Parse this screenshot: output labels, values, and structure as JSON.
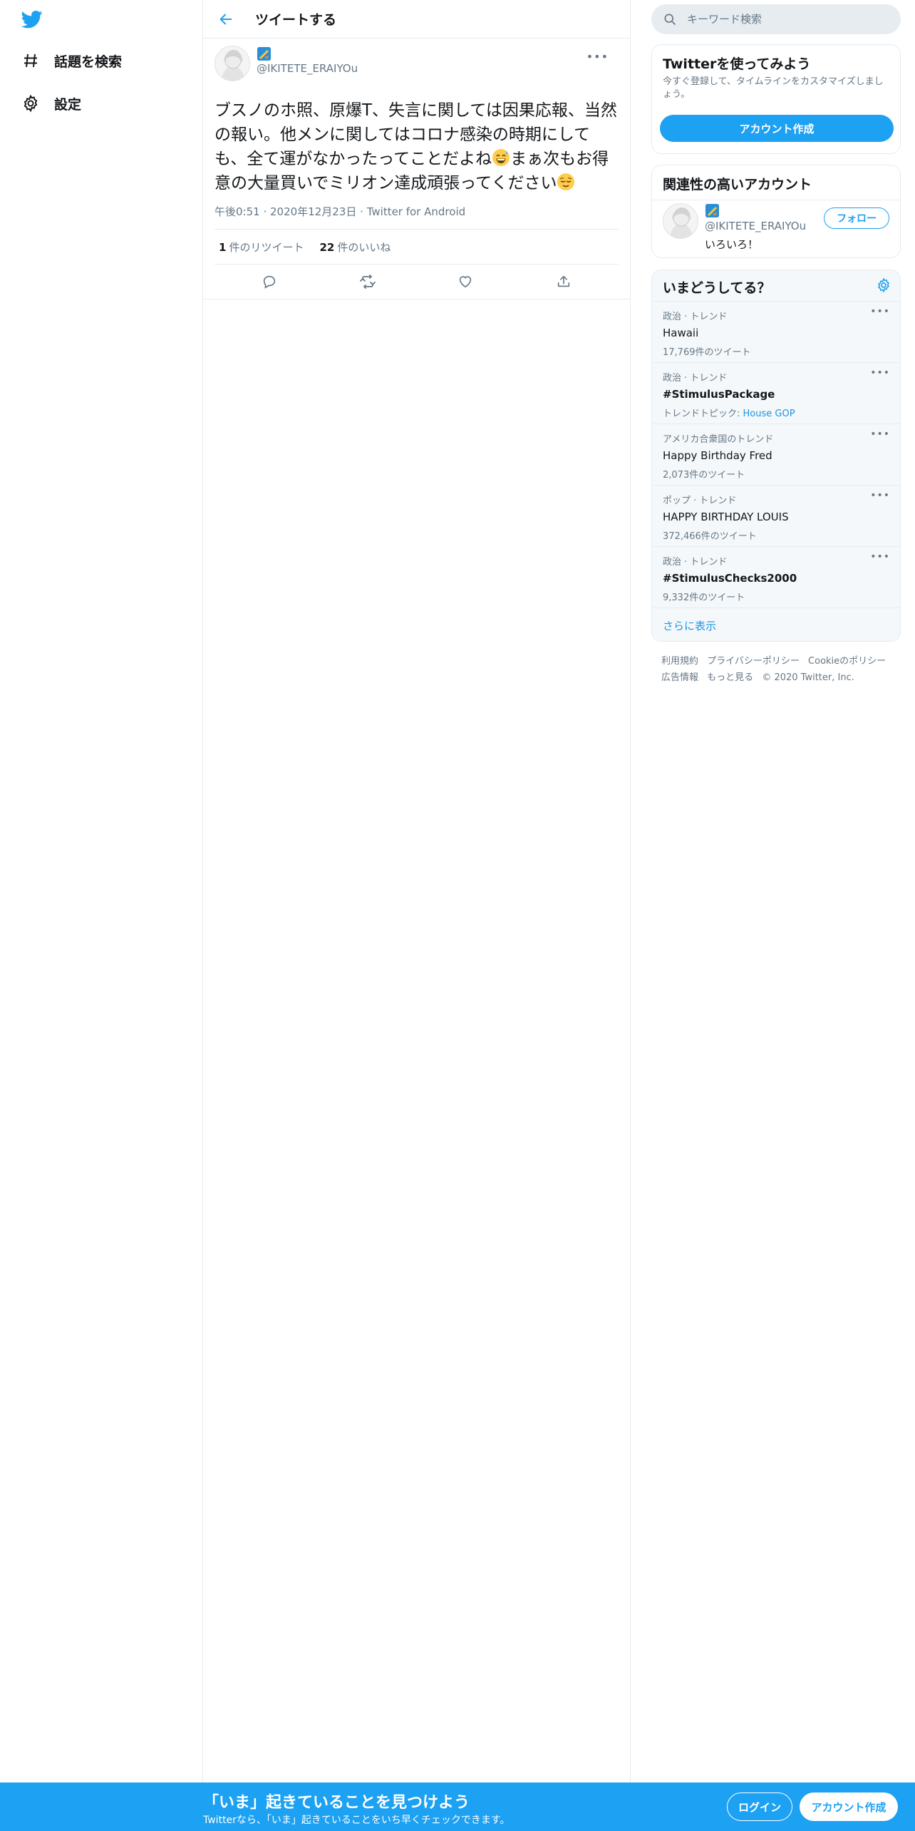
{
  "brand": {
    "accent": "#1da1f2",
    "logo": "twitter-bird-icon"
  },
  "sidebar": {
    "items": [
      {
        "icon": "hashtag-icon",
        "label": "話題を検索"
      },
      {
        "icon": "gear-icon",
        "label": "設定"
      }
    ]
  },
  "header": {
    "title": "ツイートする",
    "back_icon": "back-arrow-icon"
  },
  "tweet": {
    "handle": "@IKITETE_ERAIYOu",
    "text_part1": "ブスノのホ照、原爆T、失言に関しては因果応報、当然の報い。他メンに関してはコロナ感染の時期にしても、全て運がなかったってことだよね",
    "text_part2": "まぁ次もお得意の大量買いでミリオン達成頑張ってください",
    "emojis": [
      "grinning-sweat-emoji",
      "relieved-face-emoji"
    ],
    "time": "午後0:51",
    "date": "2020年12月23日",
    "client": "Twitter for Android",
    "retweets": {
      "count": "1",
      "label": "件のリツイート"
    },
    "likes": {
      "count": "22",
      "label": "件のいいね"
    },
    "actions": [
      "reply-icon",
      "retweet-icon",
      "like-icon",
      "share-icon"
    ]
  },
  "search": {
    "placeholder": "キーワード検索"
  },
  "signup_card": {
    "title": "Twitterを使ってみよう",
    "desc": "今すぐ登録して、タイムラインをカスタマイズしましょう。",
    "button": "アカウント作成"
  },
  "related": {
    "title": "関連性の高いアカウント",
    "handle": "@IKITETE_ERAIYOu",
    "bio": "いろいろ！",
    "follow": "フォロー"
  },
  "trends": {
    "title": "いまどうしてる？",
    "items": [
      {
        "context": "政治 · トレンド",
        "name": "Hawaii",
        "count": "17,769件のツイート"
      },
      {
        "context": "政治 · トレンド",
        "name": "#StimulusPackage",
        "topic_label": "トレンドトピック: ",
        "topic": "House GOP"
      },
      {
        "context": "アメリカ合衆国のトレンド",
        "name": "Happy Birthday Fred",
        "count": "2,073件のツイート"
      },
      {
        "context": "ポップ · トレンド",
        "name": "HAPPY BIRTHDAY LOUIS",
        "count": "372,466件のツイート"
      },
      {
        "context": "政治 · トレンド",
        "name": "#StimulusChecks2000",
        "count": "9,332件のツイート"
      }
    ],
    "show_more": "さらに表示"
  },
  "footer": {
    "links": [
      "利用規約",
      "プライバシーポリシー",
      "Cookieのポリシー",
      "広告情報",
      "もっと見る"
    ],
    "copyright": "© 2020 Twitter, Inc."
  },
  "banner": {
    "title": "「いま」起きていることを見つけよう",
    "subtitle": "Twitterなら、「いま」起きていることをいち早くチェックできます。",
    "login": "ログイン",
    "signup": "アカウント作成"
  }
}
